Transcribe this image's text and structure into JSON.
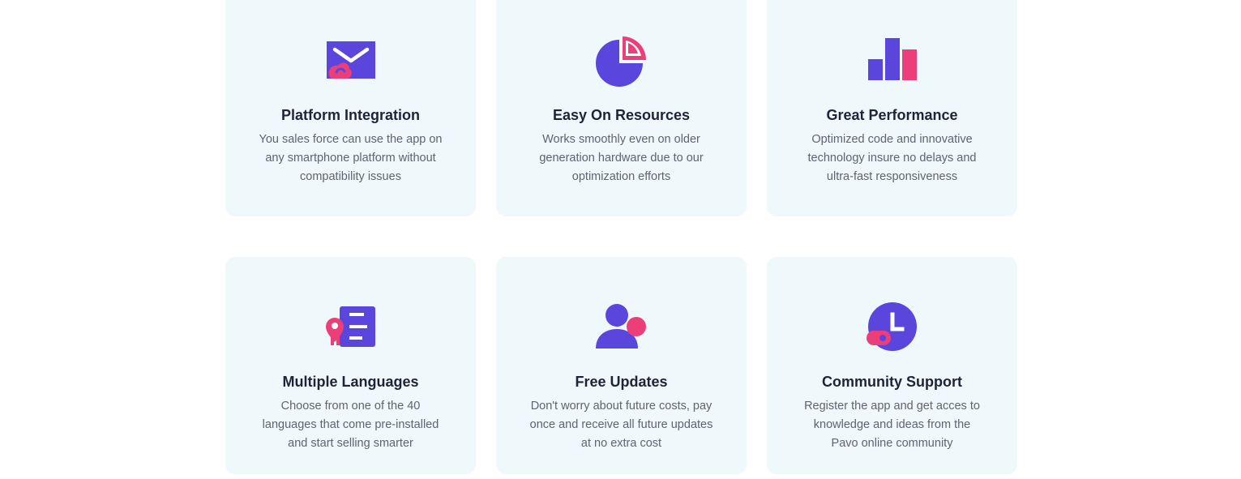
{
  "colors": {
    "primary": "#5a45dd",
    "accent": "#ec3f7a",
    "card_bg": "#eff8fb",
    "title": "#1f2335",
    "text": "#5e6470"
  },
  "features": [
    {
      "icon": "envelope-icon",
      "title": "Platform Integration",
      "description": "You sales force can use the app on any smartphone platform without compatibility issues"
    },
    {
      "icon": "pie-chart-icon",
      "title": "Easy On Resources",
      "description": "Works smoothly even on older generation hardware due to our optimization efforts"
    },
    {
      "icon": "bar-chart-icon",
      "title": "Great Performance",
      "description": "Optimized code and innovative technology insure no delays and ultra-fast responsiveness"
    },
    {
      "icon": "language-list-icon",
      "title": "Multiple Languages",
      "description": "Choose from one of the 40 languages that come pre-installed and start selling smarter"
    },
    {
      "icon": "user-updates-icon",
      "title": "Free Updates",
      "description": "Don't worry about future costs, pay once and receive all future updates at no extra cost"
    },
    {
      "icon": "clock-icon",
      "title": "Community Support",
      "description": "Register the app and get acces to knowledge and ideas from the Pavo online community"
    }
  ]
}
